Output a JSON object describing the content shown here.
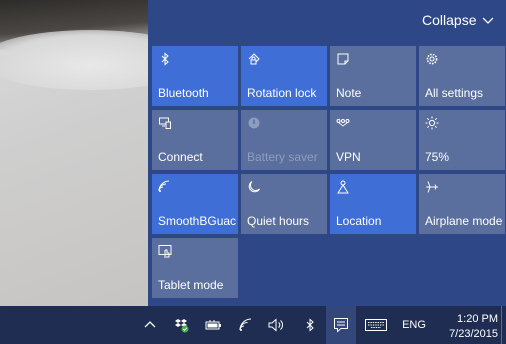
{
  "action_center": {
    "collapse_label": "Collapse",
    "tiles": [
      {
        "label": "Bluetooth",
        "icon": "bluetooth-icon",
        "state": "on"
      },
      {
        "label": "Rotation lock",
        "icon": "rotation-lock-icon",
        "state": "on"
      },
      {
        "label": "Note",
        "icon": "note-icon",
        "state": "off"
      },
      {
        "label": "All settings",
        "icon": "gear-icon",
        "state": "off"
      },
      {
        "label": "Connect",
        "icon": "connect-icon",
        "state": "off"
      },
      {
        "label": "Battery saver",
        "icon": "battery-saver-icon",
        "state": "disabled"
      },
      {
        "label": "VPN",
        "icon": "vpn-icon",
        "state": "off"
      },
      {
        "label": "75%",
        "icon": "brightness-icon",
        "state": "off"
      },
      {
        "label": "SmoothBGuac",
        "icon": "wifi-icon",
        "state": "on"
      },
      {
        "label": "Quiet hours",
        "icon": "moon-icon",
        "state": "off"
      },
      {
        "label": "Location",
        "icon": "location-icon",
        "state": "on"
      },
      {
        "label": "Airplane mode",
        "icon": "airplane-icon",
        "state": "off"
      },
      {
        "label": "Tablet mode",
        "icon": "tablet-mode-icon",
        "state": "off"
      }
    ]
  },
  "taskbar": {
    "tray_icons": [
      "chevron-up-icon",
      "dropbox-icon",
      "battery-icon",
      "wifi-icon",
      "volume-icon",
      "bluetooth-icon",
      "action-center-icon",
      "keyboard-icon"
    ],
    "language": "ENG",
    "time": "1:20 PM",
    "date": "7/23/2015"
  },
  "colors": {
    "tile_on": "#3f6ed6",
    "tile_off": "#5a6f9d",
    "panel_bg": "#2e4787",
    "taskbar_bg": "#1f2d52"
  }
}
